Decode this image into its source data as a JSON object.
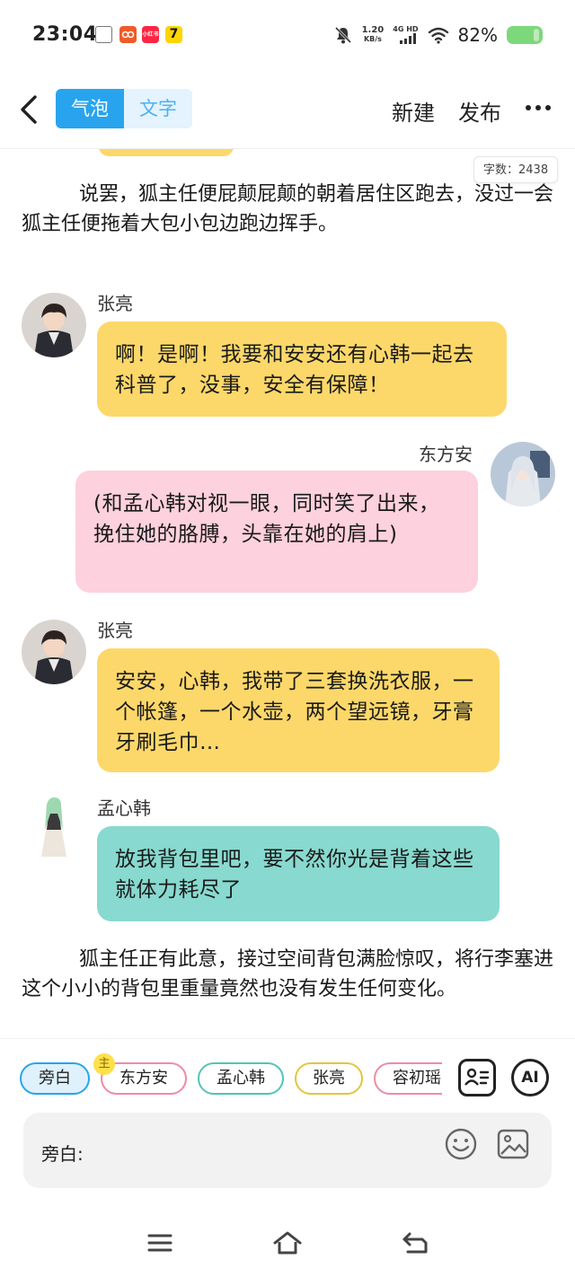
{
  "status_bar": {
    "time": "23:04",
    "net_speed_value": "1.20",
    "net_speed_unit": "KB/s",
    "network_type": "4G HD",
    "battery_percent": "82%",
    "battery_color": "#7dd87b",
    "app_icons": [
      "doc-icon",
      "taobao-icon",
      "xiaohongshu-icon",
      "seven-cat-icon"
    ],
    "xhs_label": "小红书",
    "seven_label": "7"
  },
  "header": {
    "tabs": [
      {
        "label": "气泡",
        "active": true
      },
      {
        "label": "文字",
        "active": false
      }
    ],
    "new_label": "新建",
    "publish_label": "发布",
    "accent_color": "#28a4ee"
  },
  "content": {
    "word_count": "字数：2438",
    "narration_1": "说罢，狐主任便屁颠屁颠的朝着居住区跑去，没过一会狐主任便拖着大包小包边跑边挥手。",
    "messages": [
      {
        "speaker": "张亮",
        "text": "啊！是啊！我要和安安还有心韩一起去科普了，没事，安全有保障！",
        "side": "left",
        "color": "#fcd86a"
      },
      {
        "speaker": "东方安",
        "text": "(和孟心韩对视一眼，同时笑了出来，挽住她的胳膊，头靠在她的肩上)",
        "side": "right",
        "color": "#fdd1dd"
      },
      {
        "speaker": "张亮",
        "text": "安安，心韩，我带了三套换洗衣服，一个帐篷，一个水壶，两个望远镜，牙膏牙刷毛巾…",
        "side": "left",
        "color": "#fcd86a"
      },
      {
        "speaker": "孟心韩",
        "text": "放我背包里吧，要不然你光是背着这些就体力耗尽了",
        "side": "left",
        "color": "#88d9cf"
      }
    ],
    "narration_2": "狐主任正有此意，接过空间背包满脸惊叹，将行李塞进这个小小的背包里重量竟然也没有发生任何变化。"
  },
  "bottom": {
    "chips": [
      "旁白",
      "东方安",
      "孟心韩",
      "张亮",
      "容初瑶"
    ],
    "main_badge": "主",
    "ai_label": "AI",
    "input_label": "旁白:"
  }
}
